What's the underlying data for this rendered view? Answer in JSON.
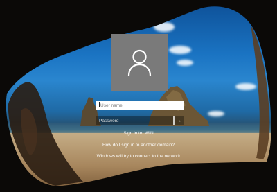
{
  "user_tile": {
    "icon": "user-icon"
  },
  "username": {
    "placeholder": "User name"
  },
  "password": {
    "placeholder": "Password"
  },
  "submit": {
    "glyph": "→",
    "icon": "arrow-right-icon"
  },
  "sign_in_to": "Sign in to: WIN",
  "other_domain_link": "How do I sign in to another domain?",
  "network_status": "Windows will try to connect to the network",
  "colors": {
    "tile": "#7a7a7a",
    "text": "#ffffff"
  }
}
